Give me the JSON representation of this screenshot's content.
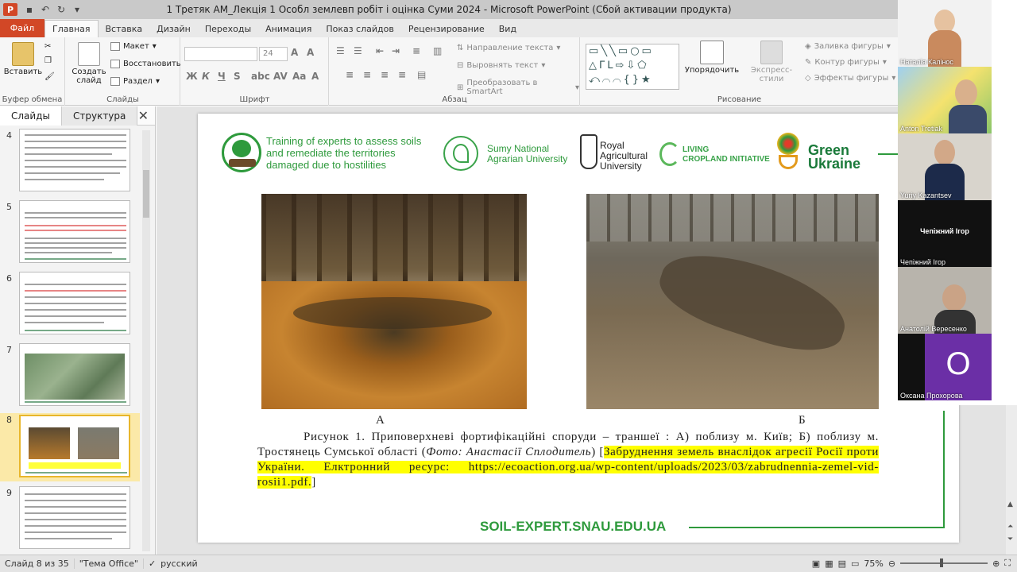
{
  "window": {
    "title": "1 Третяк АМ_Лекція 1 Особл землевп робіт і оцінка Суми 2024  -  Microsoft PowerPoint (Сбой активации продукта)"
  },
  "tabs": {
    "file": "Файл",
    "items": [
      "Главная",
      "Вставка",
      "Дизайн",
      "Переходы",
      "Анимация",
      "Показ слайдов",
      "Рецензирование",
      "Вид"
    ]
  },
  "ribbon": {
    "clipboard": {
      "paste": "Вставить",
      "label": "Буфер обмена"
    },
    "slides": {
      "create": "Создать слайд",
      "layout": "Макет",
      "reset": "Восстановить",
      "section": "Раздел",
      "label": "Слайды"
    },
    "font": {
      "size": "24",
      "label": "Шрифт"
    },
    "paragraph": {
      "text_direction": "Направление текста",
      "align_text": "Выровнять текст",
      "smartart": "Преобразовать в SmartArt",
      "label": "Абзац"
    },
    "drawing": {
      "arrange": "Упорядочить",
      "quick_styles": "Экспресс-стили",
      "fill": "Заливка фигуры",
      "outline": "Контур фигуры",
      "effects": "Эффекты фигуры",
      "label": "Рисование"
    }
  },
  "panel": {
    "tab_slides": "Слайды",
    "tab_outline": "Структура",
    "thumbnails": [
      "4",
      "5",
      "6",
      "7",
      "8",
      "9"
    ],
    "selected": "8"
  },
  "slide": {
    "project_text": [
      "Training of experts to assess soils",
      "and remediate the territories",
      "damaged due to hostilities"
    ],
    "snau": [
      "Sumy National",
      "Agrarian University"
    ],
    "rau": [
      "Royal",
      "Agricultural",
      "University"
    ],
    "lci": [
      "LIVING",
      "CROPLAND INITIATIVE"
    ],
    "gu": [
      "Green",
      "Ukraine"
    ],
    "label_a": "А",
    "label_b": "Б",
    "caption_main": "Рисунок 1. Приповерхневі фортифікаційні споруди – траншеї : А) поблизу м. Київ; Б) поблизу м. Тростянець Сумської області (",
    "caption_italic": "Фото: Анастасії Сплодитель",
    "caption_close": ") [",
    "caption_highlight": "Забруднення земель внаслідок агресії Росії проти України. Елктронний ресурс: https://ecoaction.org.ua/wp-content/uploads/2023/03/zabrudnennia-zemel-vid-rosii1.pdf.",
    "caption_end": "]",
    "footer": "SOIL-EXPERT.SNAU.EDU.UA"
  },
  "participants": [
    {
      "name": "Наталія Калінос"
    },
    {
      "name": "Anton Tretiak"
    },
    {
      "name": "Yuriy Kazantsev"
    },
    {
      "name": "Чепіжний Ігор",
      "center": "Чепіжний Ігор"
    },
    {
      "name": "Анатолій Вересенко"
    },
    {
      "name": "Оксана Прохорова",
      "initial": "О"
    }
  ],
  "status": {
    "slide": "Слайд 8 из 35",
    "theme": "\"Тема Office\"",
    "language": "русский",
    "zoom": "75%"
  },
  "colors": {
    "accent": "#d24726",
    "brand_green": "#2e9a3c",
    "highlight": "#ffff00"
  }
}
